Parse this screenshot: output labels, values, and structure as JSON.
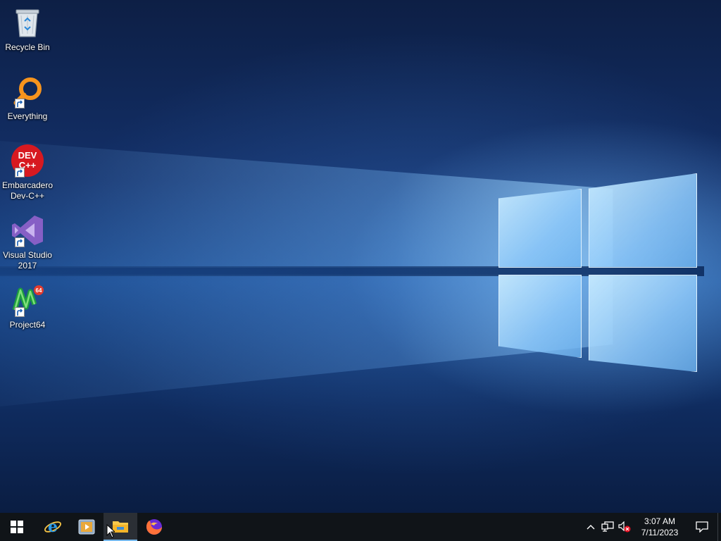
{
  "desktop": {
    "icons": [
      {
        "label": "Recycle Bin",
        "icon": "recycle-bin-icon",
        "shortcut": false
      },
      {
        "label": "Everything",
        "icon": "everything-search-icon",
        "shortcut": true
      },
      {
        "label": "Embarcadero\nDev-C++",
        "icon": "devcpp-icon",
        "shortcut": true
      },
      {
        "label": "Visual Studio\n2017",
        "icon": "visual-studio-icon",
        "shortcut": true
      },
      {
        "label": "Project64",
        "icon": "project64-icon",
        "shortcut": true
      }
    ],
    "devcpp_badge": {
      "line1": "DEV",
      "line2": "C++"
    },
    "project64_badge": "64"
  },
  "taskbar": {
    "apps": [
      {
        "icon": "internet-explorer-icon",
        "active": false
      },
      {
        "icon": "media-player-icon",
        "active": false
      },
      {
        "icon": "file-explorer-icon",
        "active": true
      },
      {
        "icon": "firefox-icon",
        "active": false
      }
    ],
    "ie_glyph": "e",
    "tray": {
      "icons": [
        "chevron-up-icon",
        "network-icon",
        "volume-muted-icon"
      ]
    },
    "clock": {
      "time": "3:07 AM",
      "date": "7/11/2023"
    }
  },
  "colors": {
    "taskbar_bg": "#101418",
    "accent": "#76b9ed",
    "everything_orange": "#f7941d",
    "devcpp_red": "#d71920",
    "vs_purple": "#865fc5",
    "firefox_orange": "#ff7139",
    "folder_yellow": "#f8c84a"
  }
}
